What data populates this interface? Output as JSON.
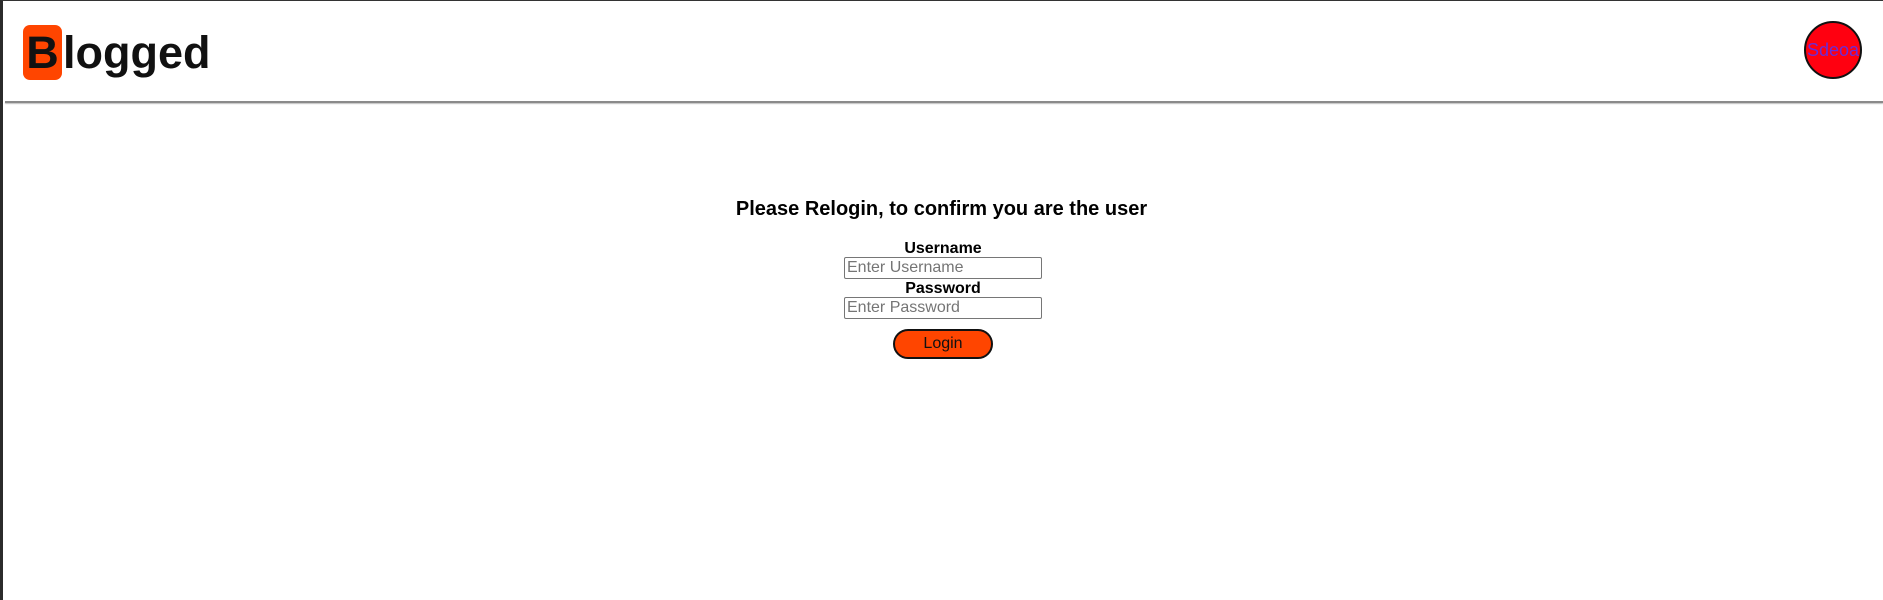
{
  "header": {
    "logo_letter": "B",
    "logo_rest": "logged",
    "user_avatar_text": "Sdeoa"
  },
  "main": {
    "title": "Please Relogin, to confirm you are the user",
    "username_label": "Username",
    "username_placeholder": "Enter Username",
    "password_label": "Password",
    "password_placeholder": "Enter Password",
    "login_label": "Login"
  },
  "colors": {
    "brand": "#ff4500",
    "avatar_bg": "#ff0010",
    "avatar_text": "#6a2bd8"
  }
}
